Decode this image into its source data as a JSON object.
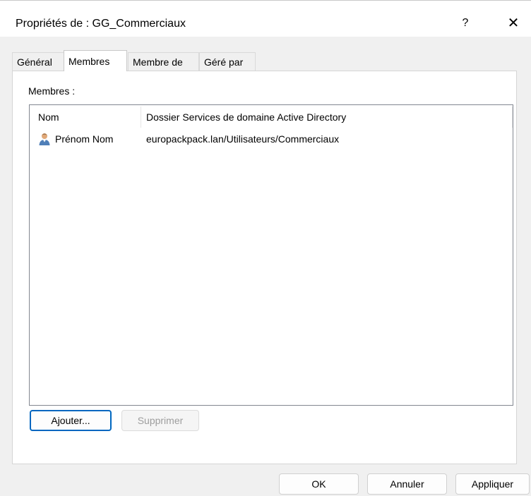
{
  "window": {
    "title": "Propriétés de : GG_Commerciaux",
    "help_label": "?",
    "close_label": "✕"
  },
  "tabs": [
    {
      "label": "Général"
    },
    {
      "label": "Membres",
      "active": true
    },
    {
      "label": "Membre de"
    },
    {
      "label": "Géré par"
    }
  ],
  "members": {
    "label": "Membres :",
    "columns": [
      "Nom",
      "Dossier Services de domaine Active Directory"
    ],
    "rows": [
      {
        "icon": "user-icon",
        "name": "Prénom Nom",
        "folder": "europackpack.lan/Utilisateurs/Commerciaux"
      }
    ],
    "add_label": "Ajouter...",
    "remove_label": "Supprimer"
  },
  "footer": {
    "ok_label": "OK",
    "cancel_label": "Annuler",
    "apply_label": "Appliquer"
  },
  "colors": {
    "accent": "#0067c0",
    "window_bg": "#f0f0f0",
    "panel_bg": "#ffffff"
  }
}
